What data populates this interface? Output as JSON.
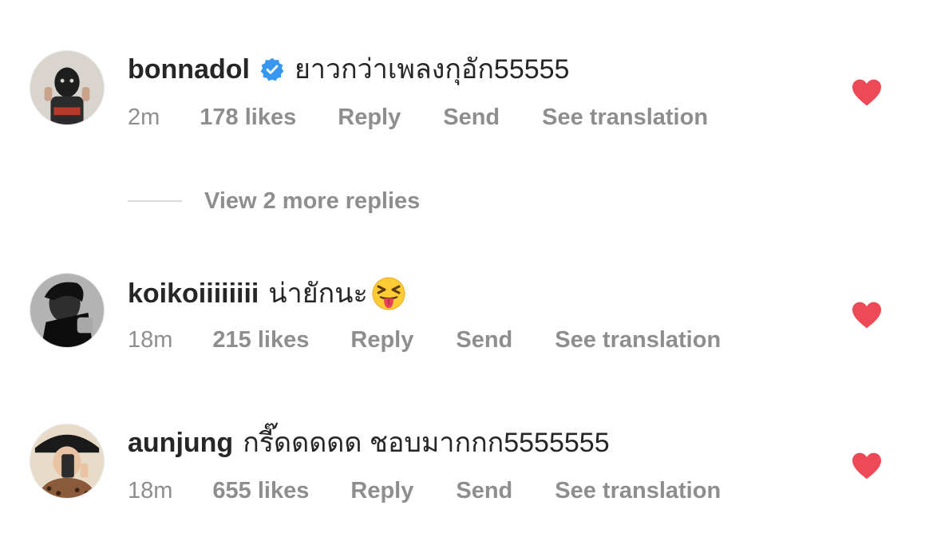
{
  "colors": {
    "heart": "#ed4956",
    "verified": "#3897f0",
    "meta_text": "#8e8e8e",
    "primary_text": "#262626"
  },
  "comments": [
    {
      "username": "bonnadol",
      "verified": true,
      "text": "ยาวกว่าเพลงกุอัก55555",
      "emoji": "",
      "time": "2m",
      "likes": "178 likes",
      "reply_label": "Reply",
      "send_label": "Send",
      "translation_label": "See translation",
      "liked": true
    },
    {
      "username": "koikoiiiiiiii",
      "verified": false,
      "text": "น่ายักนะ",
      "emoji": "squinting-face-with-tongue",
      "time": "18m",
      "likes": "215 likes",
      "reply_label": "Reply",
      "send_label": "Send",
      "translation_label": "See translation",
      "liked": true
    },
    {
      "username": "aunjung",
      "verified": false,
      "text": "กรี๊ดดดดด ชอบมากกก5555555",
      "emoji": "",
      "time": "18m",
      "likes": "655 likes",
      "reply_label": "Reply",
      "send_label": "Send",
      "translation_label": "See translation",
      "liked": true
    }
  ],
  "view_replies_label": "View 2 more replies",
  "icons": {
    "verified": "verified-badge-icon",
    "heart": "heart-filled-icon"
  }
}
